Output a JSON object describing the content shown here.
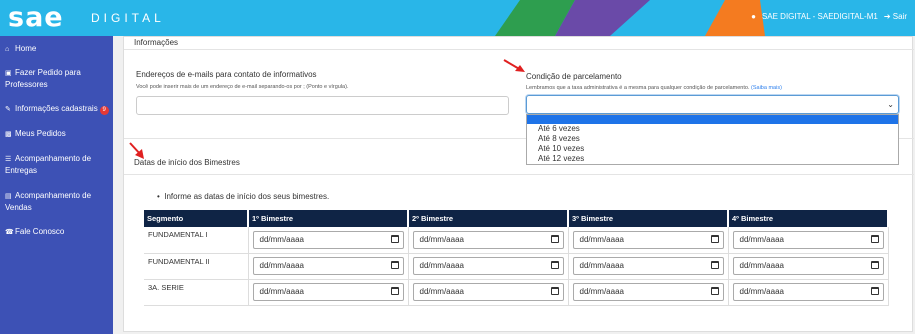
{
  "header": {
    "logo": "sae",
    "logo_sub": "DIGITAL",
    "user": "SAE DIGITAL - SAEDIGITAL-M1",
    "logout": "Sair",
    "colors": {
      "blue": "#29b6e8",
      "green": "#2e9e4f",
      "purple": "#6a4aa8",
      "orange": "#f47b20"
    }
  },
  "sidebar": {
    "items": [
      {
        "icon": "home-icon",
        "label": "Home"
      },
      {
        "icon": "cart-icon",
        "label": "Fazer Pedido para Professores"
      },
      {
        "icon": "edit-icon",
        "label": "Informações cadastrais",
        "badge": "9"
      },
      {
        "icon": "truck-icon",
        "label": "Meus Pedidos"
      },
      {
        "icon": "list-icon",
        "label": "Acompanhamento de Entregas"
      },
      {
        "icon": "money-icon",
        "label": "Acompanhamento de Vendas"
      },
      {
        "icon": "phone-icon",
        "label": "Fale Conosco"
      }
    ]
  },
  "info": {
    "title": "Informações",
    "email_label": "Endereços de e-mails para contato de informativos",
    "email_hint": "Você pode inserir mais de um endereço de e-mail separando-os por ; (Ponto e vírgula).",
    "email_value": "",
    "parcel_label": "Condição de parcelamento",
    "parcel_hint": "Lembramos que a taxa administrativa é a mesma para qualquer condição de parcelamento.",
    "parcel_link": "(Saiba mais)",
    "parcel_value": "",
    "options": [
      "",
      "Até 6 vezes",
      "Até 8 vezes",
      "Até 10 vezes",
      "Até 12 vezes"
    ]
  },
  "dates": {
    "title": "Datas de início dos Bimestres",
    "bullet": "Informe as datas de início dos seus bimestres.",
    "columns": [
      "Segmento",
      "1º Bimestre",
      "2º Bimestre",
      "3º Bimestre",
      "4º Bimestre"
    ],
    "placeholder": "dd/mm/aaaa",
    "rows": [
      {
        "segment": "FUNDAMENTAL I"
      },
      {
        "segment": "FUNDAMENTAL II"
      },
      {
        "segment": "3A. SERIE"
      }
    ]
  }
}
